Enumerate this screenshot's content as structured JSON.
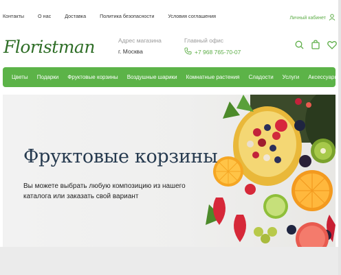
{
  "topnav": {
    "links": [
      "Контакты",
      "О нас",
      "Доставка",
      "Политика безопасности",
      "Условия соглашения"
    ],
    "account_label": "Личный кабинет"
  },
  "header": {
    "logo": "Floristman",
    "store_label": "Адрес магазина",
    "store_value": "г. Москва",
    "office_label": "Главный офис",
    "office_phone": "+7 968 765-70-07"
  },
  "icons": {
    "search": "search-icon",
    "bag": "bag-icon",
    "heart": "heart-icon",
    "user": "user-icon",
    "phone": "phone-icon"
  },
  "menu": {
    "items": [
      "Цветы",
      "Подарки",
      "Фруктовые корзины",
      "Воздушные шарики",
      "Комнатные растения",
      "Сладости",
      "Услуги",
      "Аксессуары"
    ]
  },
  "hero": {
    "title": "Фруктовые корзины",
    "subtitle": "Вы можете выбрать любую композицию из нашего каталога или заказать свой вариант"
  },
  "colors": {
    "accent": "#5cb348",
    "logo": "#2f6e27",
    "title": "#263a4f"
  }
}
